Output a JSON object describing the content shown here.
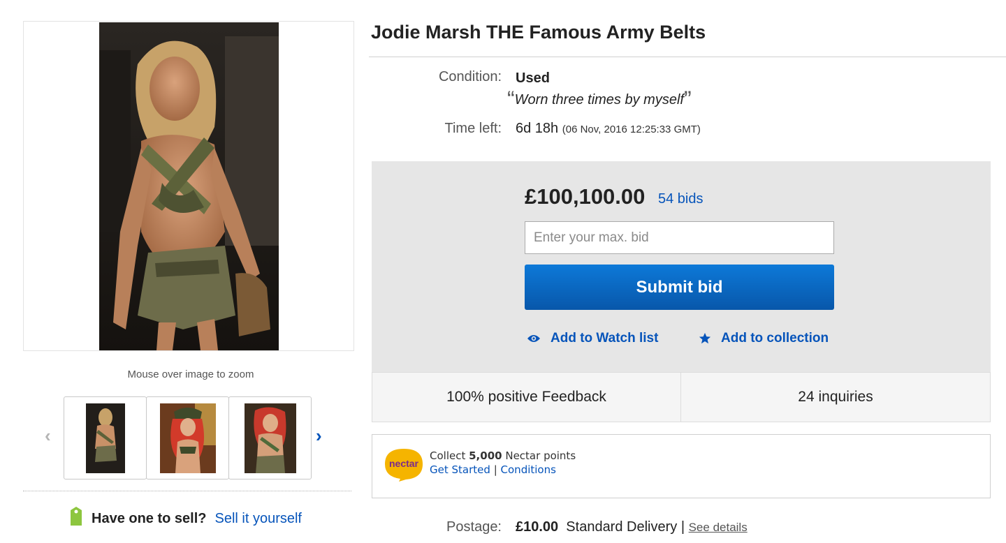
{
  "gallery": {
    "zoom_hint": "Mouse over image to zoom",
    "prev_arrow": "‹",
    "next_arrow": "›",
    "thumbnail_count": 3
  },
  "sell": {
    "question": "Have one to sell?",
    "link": "Sell it yourself"
  },
  "item": {
    "title": "Jodie Marsh THE Famous Army Belts",
    "condition_label": "Condition:",
    "condition_value": "Used",
    "condition_note": "Worn three times by myself",
    "time_label": "Time left:",
    "time_value": "6d 18h",
    "time_detail": "(06 Nov, 2016   12:25:33 GMT)"
  },
  "bid": {
    "price": "£100,100.00",
    "bid_count": "54 bids",
    "input_placeholder": "Enter your max. bid",
    "submit_label": "Submit bid",
    "watch_label": "Add to Watch list",
    "collection_label": "Add to collection"
  },
  "stats": {
    "feedback": "100% positive Feedback",
    "inquiries": "24 inquiries"
  },
  "nectar": {
    "logo_text": "nectar",
    "collect_prefix": "Collect",
    "points": "5,000",
    "collect_suffix": "Nectar points",
    "get_started": "Get Started",
    "separator": "|",
    "conditions": "Conditions"
  },
  "postage": {
    "label": "Postage:",
    "amount": "£10.00",
    "service": "Standard Delivery",
    "separator": "|",
    "details_link": "See details"
  },
  "colors": {
    "link_blue": "#0654ba",
    "button_blue": "#0d79d8",
    "panel_grey": "#e6e6e6",
    "nectar_yellow": "#f5b400",
    "nectar_purple": "#7a2a8c"
  }
}
